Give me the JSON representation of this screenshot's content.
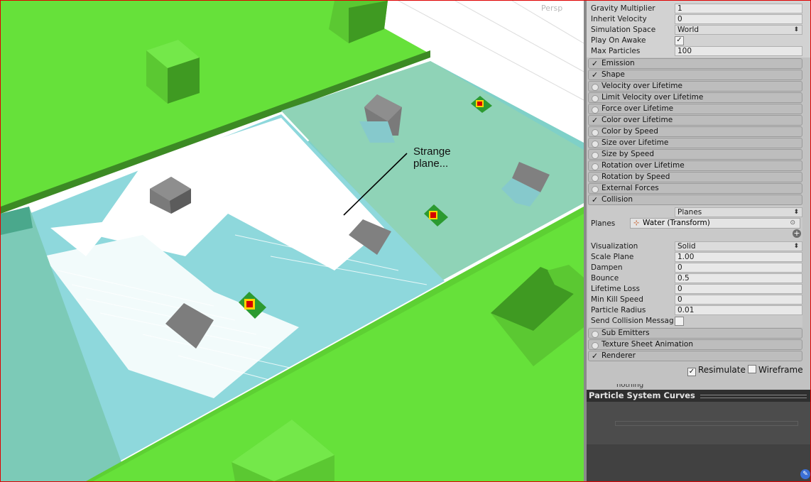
{
  "scene": {
    "camera_label": "Persp",
    "annotation_line1": "Strange",
    "annotation_line2": "plane..."
  },
  "inspector": {
    "gravity_multiplier": {
      "label": "Gravity Multiplier",
      "value": "1"
    },
    "inherit_velocity": {
      "label": "Inherit Velocity",
      "value": "0"
    },
    "simulation_space": {
      "label": "Simulation Space",
      "value": "World"
    },
    "play_on_awake": {
      "label": "Play On Awake",
      "checked": true
    },
    "max_particles": {
      "label": "Max Particles",
      "value": "100"
    },
    "modules": [
      {
        "label": "Emission",
        "enabled": true
      },
      {
        "label": "Shape",
        "enabled": true
      },
      {
        "label": "Velocity over Lifetime",
        "enabled": false
      },
      {
        "label": "Limit Velocity over Lifetime",
        "enabled": false
      },
      {
        "label": "Force over Lifetime",
        "enabled": false
      },
      {
        "label": "Color over Lifetime",
        "enabled": true
      },
      {
        "label": "Color by Speed",
        "enabled": false
      },
      {
        "label": "Size over Lifetime",
        "enabled": false
      },
      {
        "label": "Size by Speed",
        "enabled": false
      },
      {
        "label": "Rotation over Lifetime",
        "enabled": false
      },
      {
        "label": "Rotation by Speed",
        "enabled": false
      },
      {
        "label": "External Forces",
        "enabled": false
      },
      {
        "label": "Collision",
        "enabled": true
      }
    ],
    "collision": {
      "type_value": "Planes",
      "planes_label": "Planes",
      "planes_value": "Water (Transform)",
      "visualization": {
        "label": "Visualization",
        "value": "Solid"
      },
      "scale_plane": {
        "label": "Scale Plane",
        "value": "1.00"
      },
      "dampen": {
        "label": "Dampen",
        "value": "0"
      },
      "bounce": {
        "label": "Bounce",
        "value": "0.5"
      },
      "lifetime_loss": {
        "label": "Lifetime Loss",
        "value": "0"
      },
      "min_kill_speed": {
        "label": "Min Kill Speed",
        "value": "0"
      },
      "particle_radius": {
        "label": "Particle Radius",
        "value": "0.01"
      },
      "send_collision_messages": {
        "label": "Send Collision Messages",
        "checked": false
      }
    },
    "modules_after": [
      {
        "label": "Sub Emitters",
        "enabled": false
      },
      {
        "label": "Texture Sheet Animation",
        "enabled": false
      },
      {
        "label": "Renderer",
        "enabled": true
      }
    ],
    "resimulate": {
      "label": "Resimulate",
      "checked": true
    },
    "wireframe": {
      "label": "Wireframe",
      "checked": false
    },
    "cut_text": "nothing"
  },
  "curves_panel": {
    "title": "Particle System Curves"
  },
  "colors": {
    "grass": "#66e13a",
    "water": "#8ed8dc",
    "accent_red": "#e00000"
  }
}
